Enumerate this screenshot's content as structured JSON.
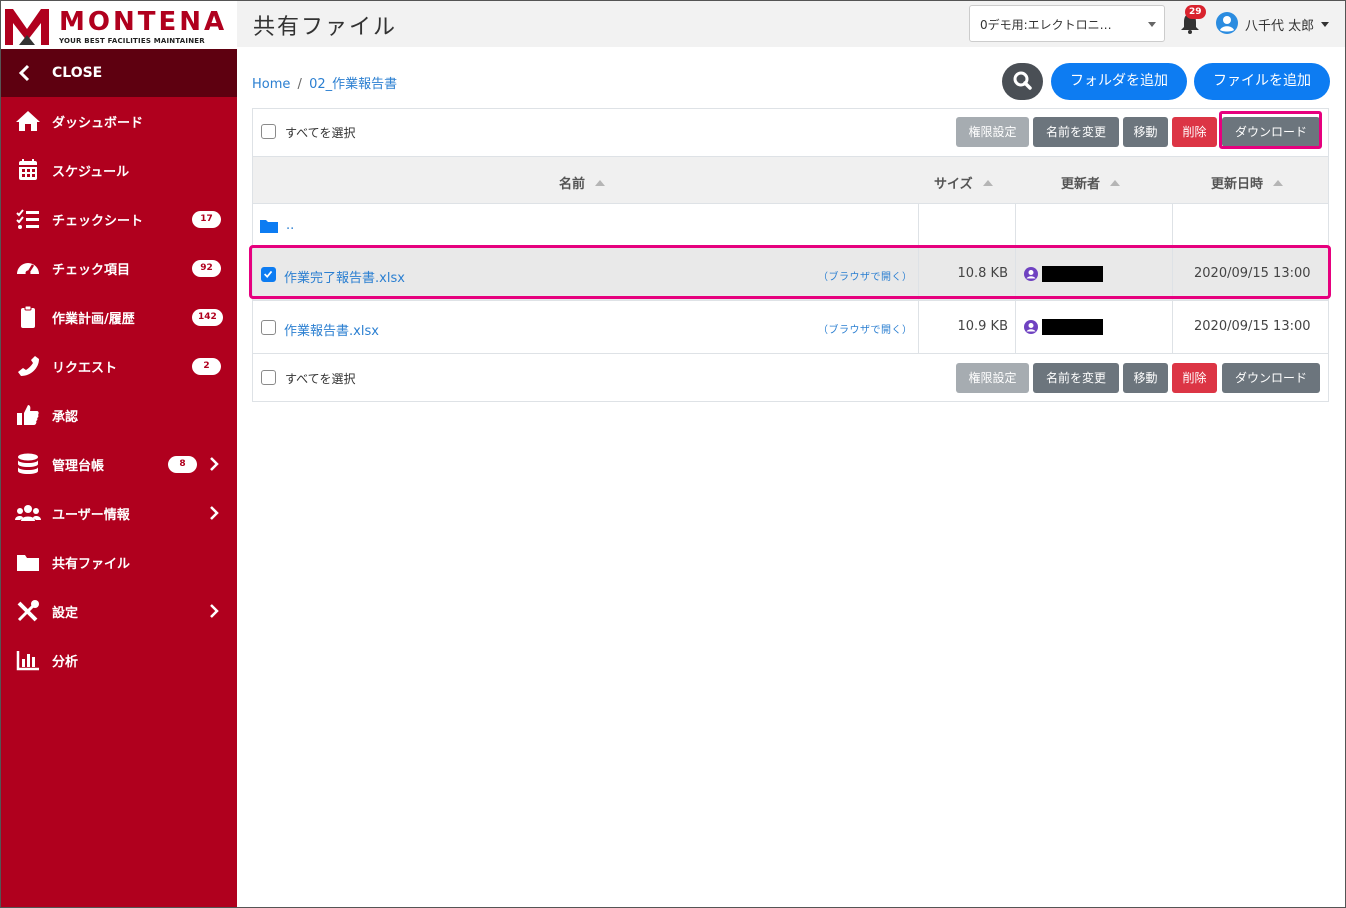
{
  "brand": {
    "name": "MONTENA",
    "tagline": "YOUR BEST FACILITIES MAINTAINER",
    "color": "#b0001e"
  },
  "sidebar": {
    "close_label": "CLOSE",
    "items": [
      {
        "label": "ダッシュボード",
        "icon": "home-icon"
      },
      {
        "label": "スケジュール",
        "icon": "calendar-icon"
      },
      {
        "label": "チェックシート",
        "icon": "checklist-icon",
        "badge": "17"
      },
      {
        "label": "チェック項目",
        "icon": "gauge-icon",
        "badge": "92"
      },
      {
        "label": "作業計画/履歴",
        "icon": "clipboard-icon",
        "badge": "142"
      },
      {
        "label": "リクエスト",
        "icon": "phone-icon",
        "badge": "2"
      },
      {
        "label": "承認",
        "icon": "thumbs-up-icon"
      },
      {
        "label": "管理台帳",
        "icon": "database-icon",
        "badge": "8",
        "has_submenu": true
      },
      {
        "label": "ユーザー情報",
        "icon": "users-icon",
        "has_submenu": true
      },
      {
        "label": "共有ファイル",
        "icon": "folder-icon"
      },
      {
        "label": "設定",
        "icon": "tools-icon",
        "has_submenu": true
      },
      {
        "label": "分析",
        "icon": "chart-icon"
      }
    ]
  },
  "header": {
    "title": "共有ファイル",
    "org_select_value": "0デモ用:エレクトロニ…",
    "notification_count": "29",
    "user_name": "八千代 太郎"
  },
  "breadcrumb": {
    "home": "Home",
    "separator": "/",
    "current": "02_作業報告書"
  },
  "actions": {
    "add_folder": "フォルダを追加",
    "add_file": "ファイルを追加"
  },
  "toolbar": {
    "select_all": "すべてを選択",
    "permissions": "権限設定",
    "rename": "名前を変更",
    "move": "移動",
    "delete": "削除",
    "download": "ダウンロード"
  },
  "table": {
    "columns": [
      "名前",
      "サイズ",
      "更新者",
      "更新日時"
    ],
    "parent_dir": "..",
    "rows": [
      {
        "name": "作業完了報告書.xlsx",
        "open": "（ブラウザで開く）",
        "size": "10.8 KB",
        "updated": "2020/09/15 13:00",
        "checked": true
      },
      {
        "name": "作業報告書.xlsx",
        "open": "（ブラウザで開く）",
        "size": "10.9 KB",
        "updated": "2020/09/15 13:00",
        "checked": false
      }
    ]
  },
  "colors": {
    "primary": "#0d7cf2",
    "danger": "#dc3545",
    "secondary": "#6c757d",
    "highlight": "#e6007e"
  }
}
